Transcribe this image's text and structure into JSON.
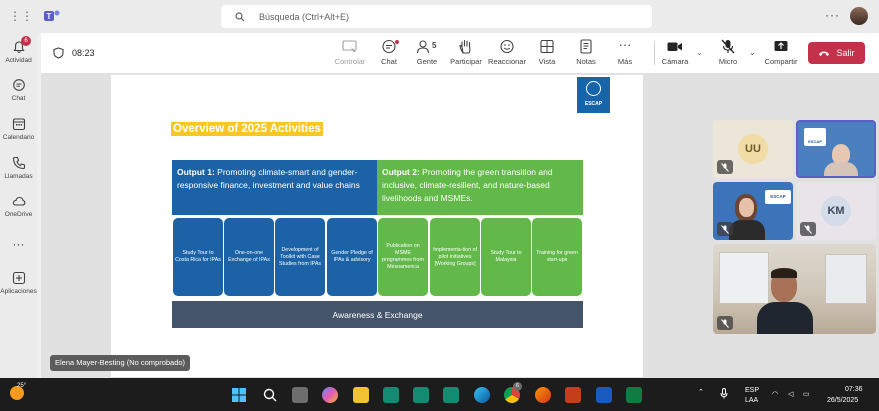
{
  "search": {
    "placeholder": "Búsqueda (Ctrl+Alt+E)"
  },
  "rail": {
    "items": [
      {
        "label": "Actividad",
        "badge": "6"
      },
      {
        "label": "Chat"
      },
      {
        "label": "Calendario"
      },
      {
        "label": "Llamadas"
      },
      {
        "label": "OneDrive"
      },
      {
        "label": "Aplicaciones"
      }
    ]
  },
  "meeting": {
    "timer": "08:23",
    "toolbar": {
      "controlar": "Controlar",
      "chat": "Chat",
      "people_count": "5",
      "gente": "Gente",
      "participar": "Participar",
      "reaccionar": "Reaccionar",
      "vista": "Vista",
      "notas": "Notas",
      "mas": "Más",
      "camara": "Cámara",
      "micro": "Micro",
      "compartir": "Compartir",
      "salir": "Salir"
    }
  },
  "slide": {
    "logo_text": "ESCAP",
    "title": "Overview of 2025 Activities",
    "output1_label": "Output 1:",
    "output1_text": "Promoting climate-smart and gender-responsive finance, investment and value chains",
    "output2_label": "Output 2:",
    "output2_text": "Promoting the green transition and inclusive, climate-resilient, and nature-based livelihoods and MSMEs.",
    "activities": [
      "Study Tour to Costa Rica for IPAs",
      "One-on-one Exchange of IPAs",
      "Development of Toolkit with Case Studies from IPAs",
      "Gender Pledge of IPAs & advisory",
      "Publication on MSME programmes from Mesoamerica",
      "Implementa-tion of pilot initiatives [Working Groups]",
      "Study Tour to Malaysia",
      "Training for green start-ups"
    ],
    "footer": "Awareness & Exchange"
  },
  "presenter_label": "Elena Mayer-Besting (No comprobado)",
  "participants": {
    "uu": "UU",
    "km": "KM",
    "tile_logo": "ESCAP"
  },
  "taskbar": {
    "temp": "25°",
    "lang1": "ESP",
    "lang2": "LAA",
    "time": "07:36",
    "date": "26/5/2025",
    "edge_badge": "6"
  },
  "colors": {
    "teams_purple": "#5b5fc7",
    "leave_red": "#c4314b",
    "output1_blue": "#1b62a6",
    "output2_green": "#62b848",
    "title_yellow": "#f9c623",
    "footer_slate": "#44546a"
  }
}
